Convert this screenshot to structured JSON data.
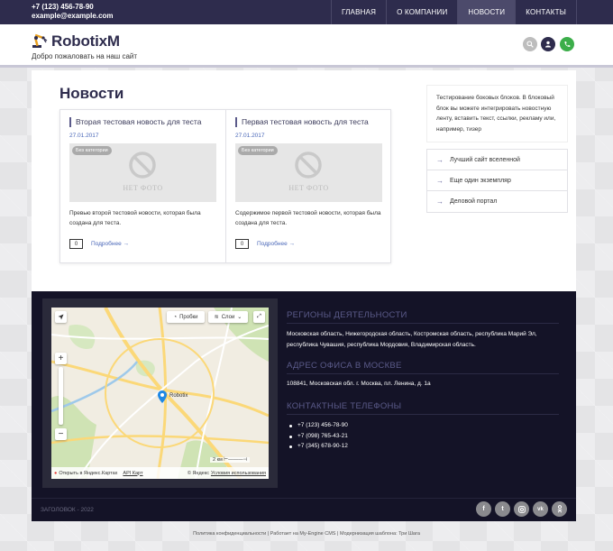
{
  "top": {
    "phone": "+7 (123) 456-78-90",
    "email": "example@example.com",
    "nav": [
      "ГЛАВНАЯ",
      "О КОМПАНИИ",
      "НОВОСТИ",
      "КОНТАКТЫ"
    ],
    "active_nav": "НОВОСТИ"
  },
  "header": {
    "logo_text": "RobotixM",
    "tagline": "Добро пожаловать на наш сайт",
    "icons": [
      "search-icon",
      "user-icon",
      "phone-icon"
    ],
    "colors": {
      "brand": "#2e2c4d",
      "search": "#bdbdbd",
      "user": "#2e2c4d",
      "phone": "#3cae4a"
    }
  },
  "main": {
    "title": "Новости",
    "news": [
      {
        "title": "Вторая тестовая новость для теста",
        "date": "27.01.2017",
        "category": "Без категории",
        "nophoto": "НЕТ ФОТО",
        "preview": "Превью второй тестовой новости, которая была создана для теста.",
        "comments": "0",
        "more": "Подробнее →"
      },
      {
        "title": "Первая тестовая новость для теста",
        "date": "27.01.2017",
        "category": "Без категории",
        "nophoto": "НЕТ ФОТО",
        "preview": "Содержимое первой тестовой новости, которая была создана для теста.",
        "comments": "0",
        "more": "Подробнее →"
      }
    ]
  },
  "sidebar": {
    "text": "Тестирование боковых блоков. В блоковый блок вы можете интегрировать новостную ленту, вставить текст, ссылки, рекламу или, например, тизер",
    "links": [
      "Лучший сайт вселенной",
      "Еще один экземпляр",
      "Деловой портал"
    ]
  },
  "map": {
    "traffic_label": "Пробки",
    "layers_label": "Слои",
    "marker_label": "Robotix",
    "scale_label": "2 км",
    "open_label": "Открыть в Яндекс.Картах",
    "api_label": "API Карт",
    "yandex_label": "© Яндекс",
    "terms_label": "Условия использования"
  },
  "footer": {
    "regions_heading": "РЕГИОНЫ ДЕЯТЕЛЬНОСТИ",
    "regions_text": "Московская область, Нижегородская область, Костромская область, республика Марий Эл, республика Чувашия, республика Мордовия, Владимирская область.",
    "address_heading": "АДРЕС ОФИСА В МОСКВЕ",
    "address_text": "108841, Московская обл. г. Москва, пл. Ленина, д. 1а",
    "phones_heading": "КОНТАКТНЫЕ ТЕЛЕФОНЫ",
    "phones": [
      "+7 (123) 456-78-90",
      "+7 (098) 765-43-21",
      "+7 (345) 678-90-12"
    ],
    "copyright": "ЗАГОЛОВОК - 2022",
    "socials": [
      "facebook-icon",
      "twitter-icon",
      "instagram-icon",
      "vk-icon",
      "odnoklassniki-icon"
    ],
    "legal": "Политика конфиденциальности | Работает на My-Engine CMS | Модернизация шаблона: Три Шага"
  }
}
